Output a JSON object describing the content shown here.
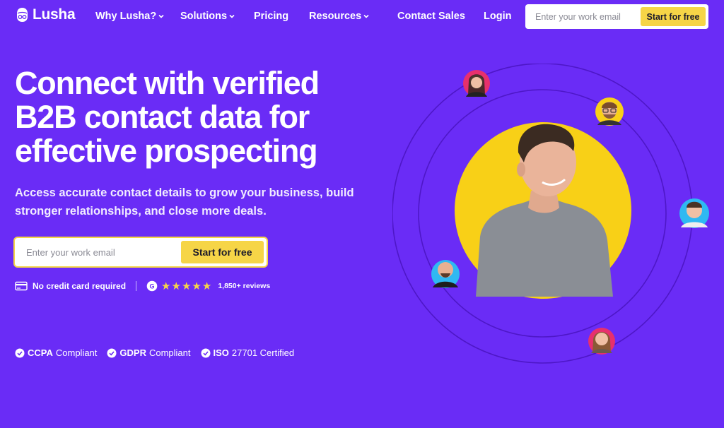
{
  "brand": {
    "name": "Lusha"
  },
  "nav": {
    "items": [
      {
        "label": "Why Lusha?",
        "has_dropdown": true
      },
      {
        "label": "Solutions",
        "has_dropdown": true
      },
      {
        "label": "Pricing",
        "has_dropdown": false
      },
      {
        "label": "Resources",
        "has_dropdown": true
      }
    ],
    "contact_sales": "Contact Sales",
    "login": "Login",
    "email_placeholder": "Enter your work email",
    "cta": "Start for free"
  },
  "hero": {
    "headline_line1": "Connect with verified",
    "headline_line2": "B2B contact data for",
    "headline_line3": "effective prospecting",
    "subhead": "Access accurate contact details to grow your business, build stronger relationships, and close more deals.",
    "email_placeholder": "Enter your work email",
    "cta": "Start for free",
    "no_card": "No credit card required",
    "rating_stars": 5,
    "reviews": "1,850+ reviews"
  },
  "compliance": [
    {
      "bold": "CCPA",
      "rest": "Compliant"
    },
    {
      "bold": "GDPR",
      "rest": "Compliant"
    },
    {
      "bold": "ISO",
      "rest": "27701 Certified"
    }
  ],
  "colors": {
    "background": "#6a2cf6",
    "accent_yellow": "#f6d547",
    "text_dark": "#1c1b2b"
  }
}
